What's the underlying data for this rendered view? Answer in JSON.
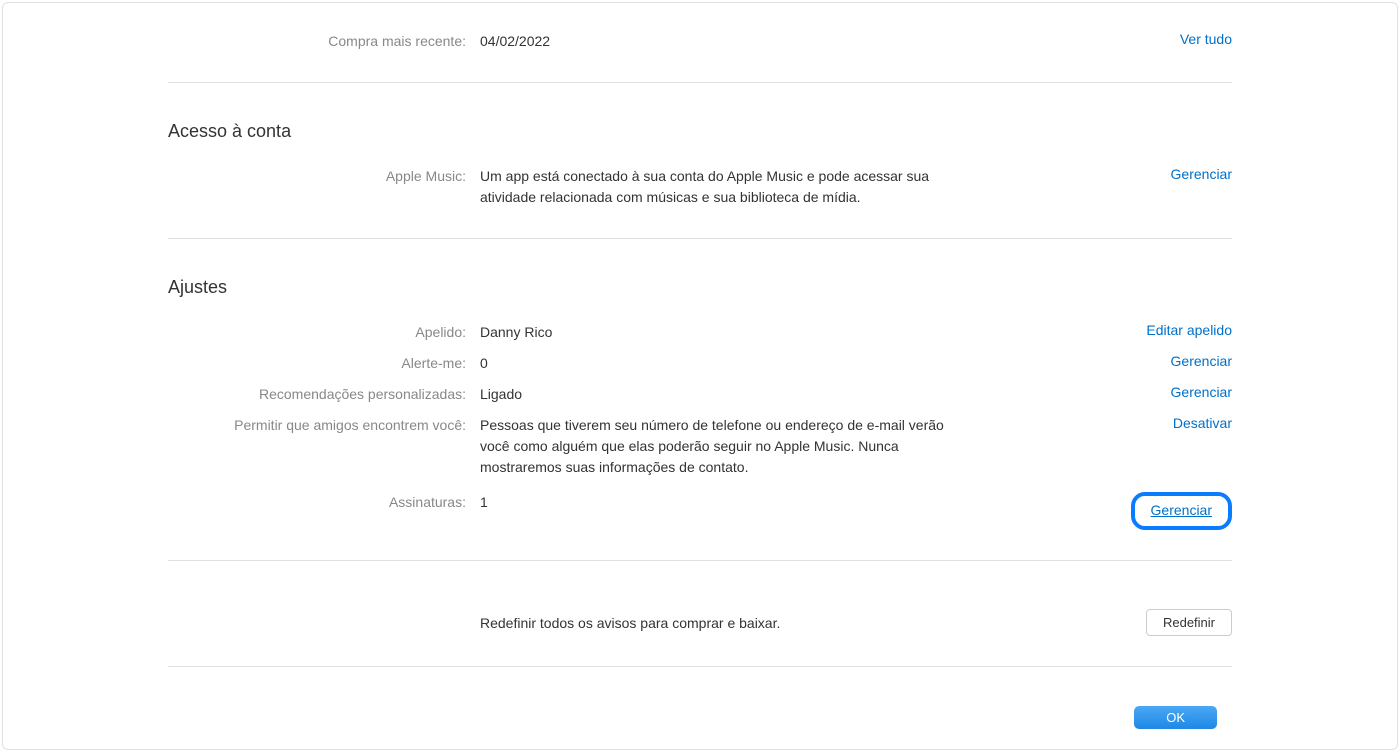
{
  "purchase": {
    "label": "Compra mais recente:",
    "value": "04/02/2022",
    "action": "Ver tudo"
  },
  "account_access": {
    "title": "Acesso à conta",
    "apple_music": {
      "label": "Apple Music:",
      "description": "Um app está conectado à sua conta do Apple Music e pode acessar sua atividade relacionada com músicas e sua biblioteca de mídia.",
      "action": "Gerenciar"
    }
  },
  "settings": {
    "title": "Ajustes",
    "nickname": {
      "label": "Apelido:",
      "value": "Danny Rico",
      "action": "Editar apelido"
    },
    "alert_me": {
      "label": "Alerte-me:",
      "value": "0",
      "action": "Gerenciar"
    },
    "recommendations": {
      "label": "Recomendações personalizadas:",
      "value": "Ligado",
      "action": "Gerenciar"
    },
    "allow_friends": {
      "label": "Permitir que amigos encontrem você:",
      "description": "Pessoas que tiverem seu número de telefone ou endereço de e-mail verão você como alguém que elas poderão seguir no Apple Music. Nunca mostraremos suas informações de contato.",
      "action": "Desativar"
    },
    "subscriptions": {
      "label": "Assinaturas:",
      "value": "1",
      "action": "Gerenciar"
    }
  },
  "reset": {
    "text": "Redefinir todos os avisos para comprar e baixar.",
    "button": "Redefinir"
  },
  "footer": {
    "ok_button": "OK"
  }
}
